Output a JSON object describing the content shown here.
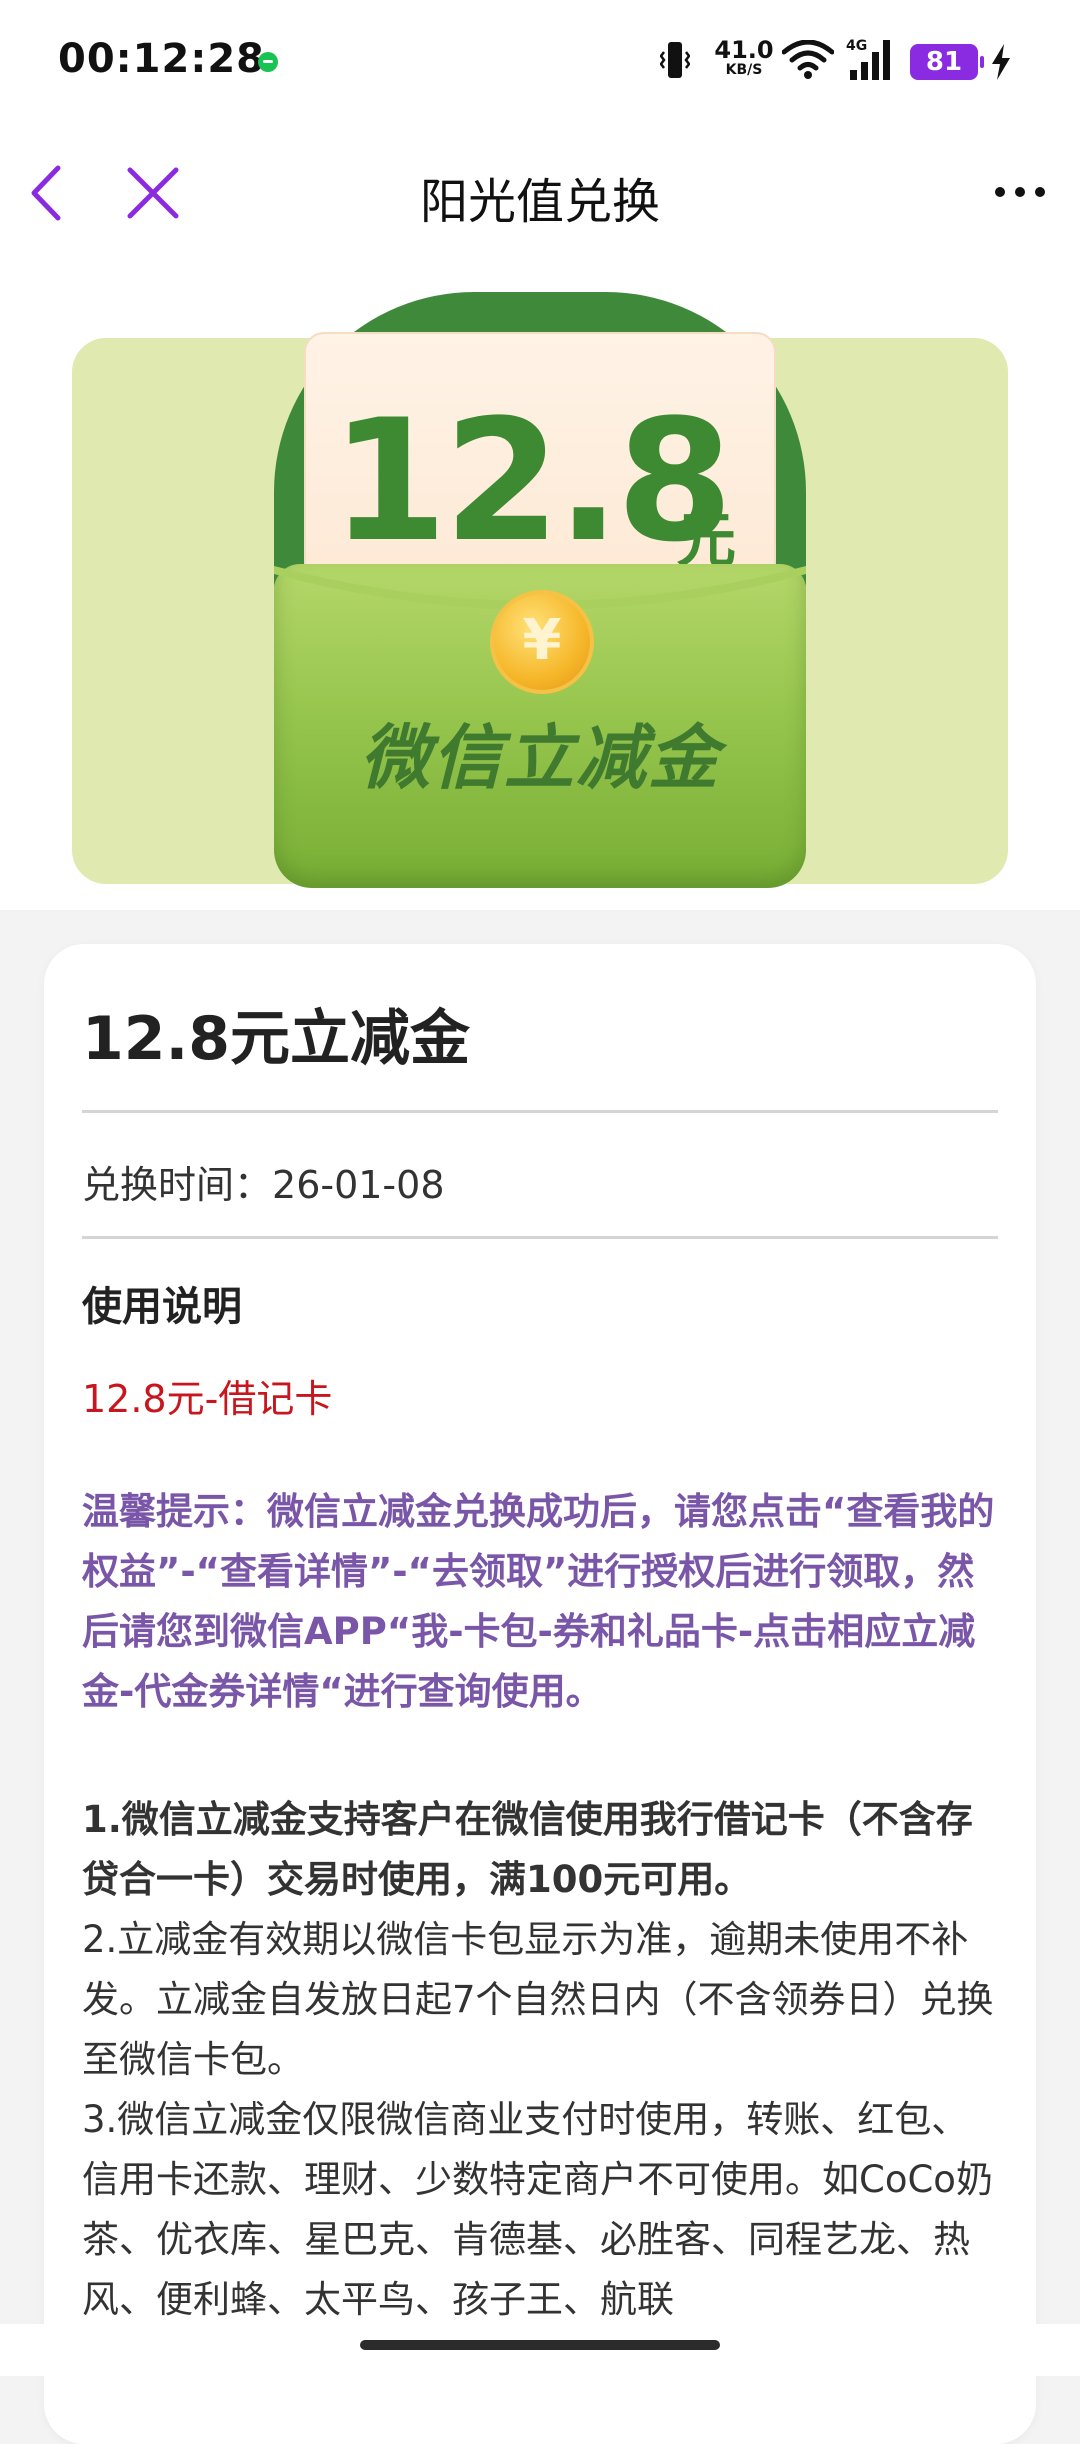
{
  "status_bar": {
    "time": "00:12:28",
    "net_speed_value": "41.0",
    "net_speed_unit": "KB/S",
    "network_type": "4G",
    "battery_level": "81",
    "accent_color": "#8a2be2",
    "icons": [
      "wechat-dot-icon",
      "vibrate-icon",
      "wifi-icon",
      "signal-icon",
      "battery-icon",
      "charging-bolt-icon"
    ]
  },
  "nav": {
    "title": "阳光值兑换",
    "back_icon": "chevron-left-icon",
    "close_icon": "close-icon",
    "more_icon": "more-icon",
    "icon_color": "#8a2be2"
  },
  "banner": {
    "amount": "12.8",
    "unit": "元",
    "currency_symbol": "¥",
    "label": "微信立减金"
  },
  "detail": {
    "title": "12.8元立减金",
    "exchange_label": "兑换时间：",
    "exchange_date": "26-01-08",
    "section_title": "使用说明",
    "card_type": "12.8元-借记卡",
    "tip": "温馨提示：微信立减金兑换成功后，请您点击“查看我的权益”-“查看详情”-“去领取”进行授权后进行领取，然后请您到微信APP“我-卡包-券和礼品卡-点击相应立减金-代金券详情“进行查询使用。",
    "rule_1": "1.微信立减金支持客户在微信使用我行借记卡（不含存贷合一卡）交易时使用，满100元可用。",
    "rule_2": "2.立减金有效期以微信卡包显示为准，逾期未使用不补发。立减金自发放日起7个自然日内（不含领券日）兑换至微信卡包。",
    "rule_3": "3.微信立减金仅限微信商业支付时使用，转账、红包、信用卡还款、理财、少数特定商户不可使用。如CoCo奶茶、优衣库、星巴克、肯德基、必胜客、同程艺龙、热风、便利蜂、太平鸟、孩子王、航联"
  }
}
